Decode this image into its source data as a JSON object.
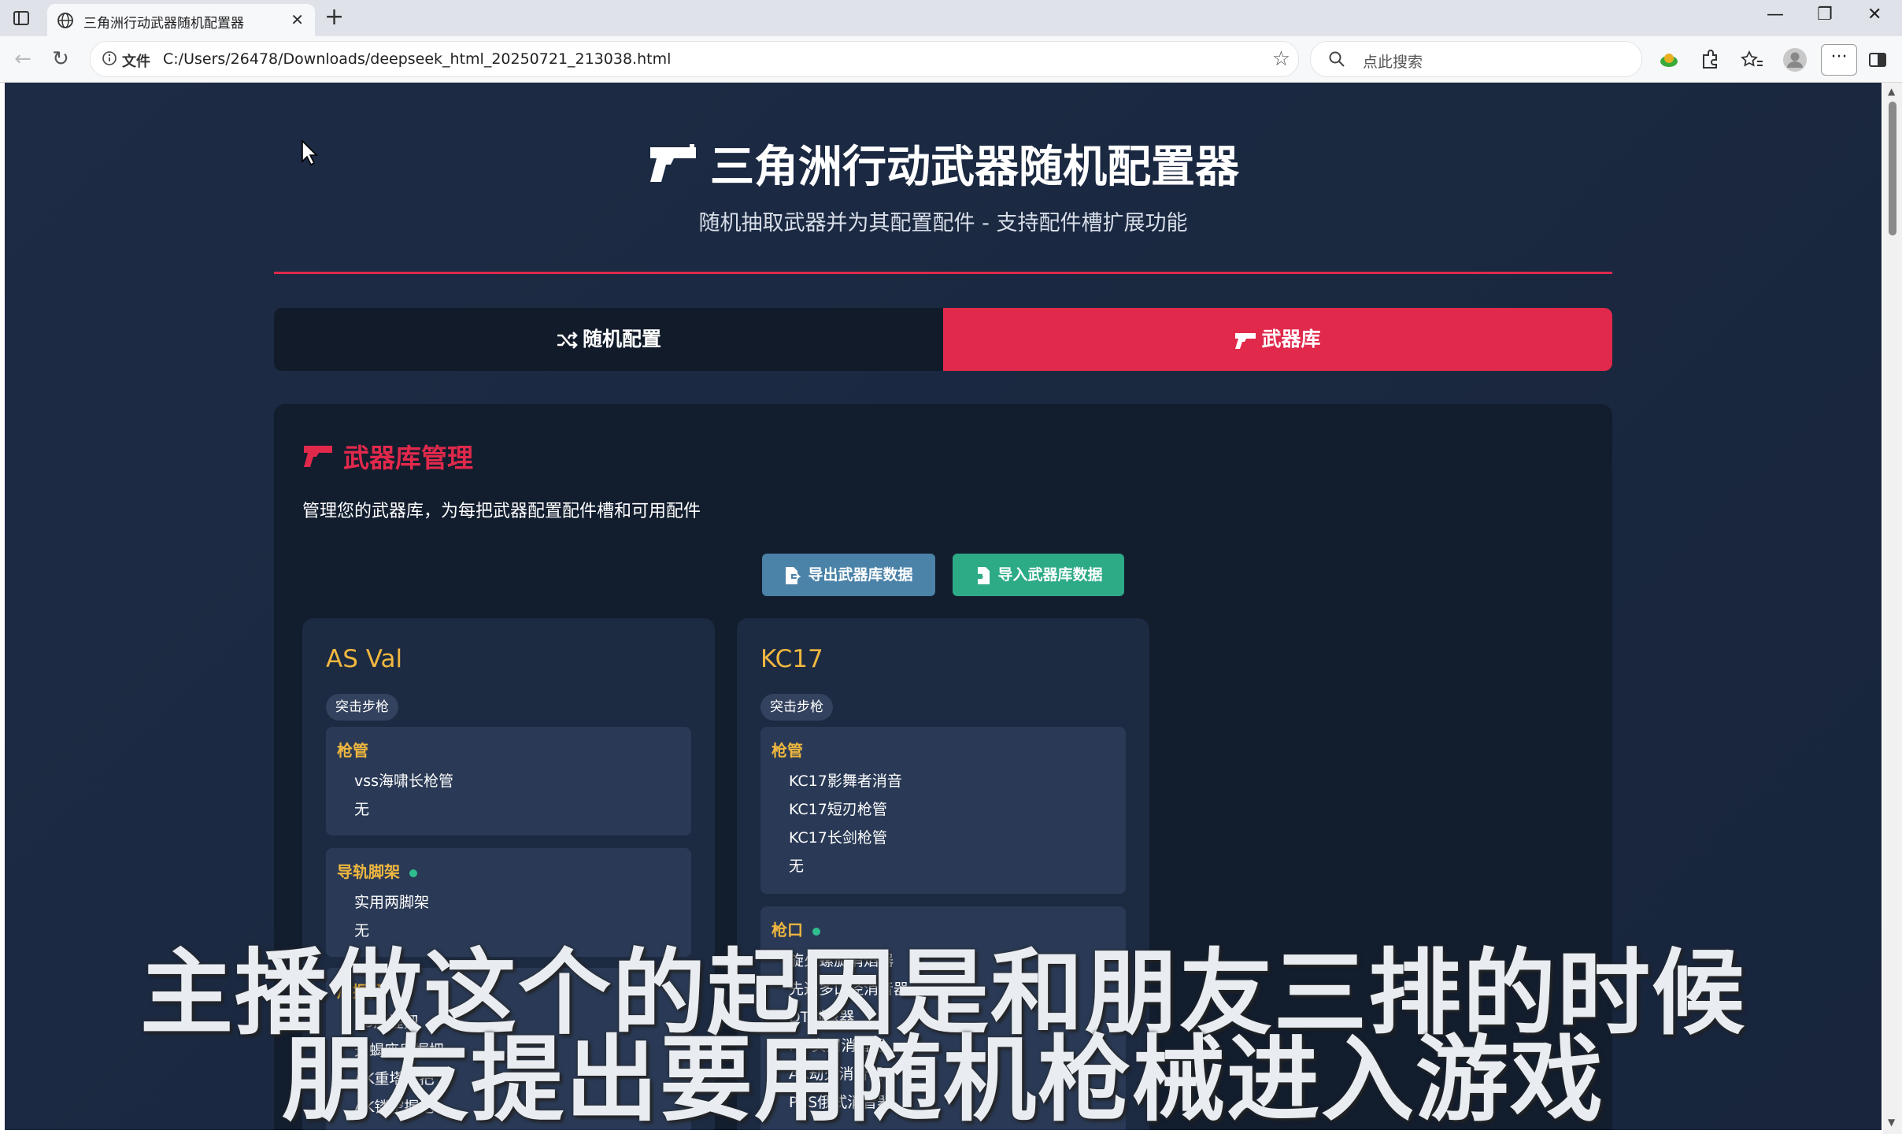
{
  "browser": {
    "tab_title": "三角洲行动武器随机配置器",
    "new_tab": "+",
    "tab_close": "✕",
    "address_label": "文件",
    "url": "C:/Users/26478/Downloads/deepseek_html_20250721_213038.html",
    "search_placeholder": "点此搜索",
    "window_controls": {
      "minimize": "—",
      "restore": "❐",
      "close": "✕"
    },
    "more": "···"
  },
  "page": {
    "title": "三角洲行动武器随机配置器",
    "subtitle": "随机抽取武器并为其配置配件 - 支持配件槽扩展功能",
    "tabs": [
      {
        "label": "随机配置",
        "active": false
      },
      {
        "label": "武器库",
        "active": true
      }
    ],
    "panel": {
      "title": "武器库管理",
      "description": "管理您的武器库，为每把武器配置配件槽和可用配件",
      "export_button": "导出武器库数据",
      "import_button": "导入武器库数据"
    },
    "weapons": [
      {
        "name": "AS Val",
        "type": "突击步枪",
        "slots": [
          {
            "name": "枪管",
            "options": [
              "vss海啸长枪管",
              "无"
            ]
          },
          {
            "name": "导轨脚架",
            "options": [
              "实用两脚架",
              "无"
            ]
          },
          {
            "name": "后握把",
            "options": [
              "K3后握把",
              "天蝎座后握把",
              "AK重塔握把",
              "AK镂空握把"
            ]
          }
        ]
      },
      {
        "name": "KC17",
        "type": "突击步枪",
        "slots": [
          {
            "name": "枪管",
            "options": [
              "KC17影舞者消音",
              "KC17短刃枪管",
              "KC17长剑枪管",
              "无"
            ]
          },
          {
            "name": "枪口",
            "options": [
              "旋火螺旋消焰器",
              "先进多口径消音器",
              "DT制退器",
              "M7实用消音器",
              "AK劫火消音器",
              "PBS俄式消音器"
            ]
          }
        ]
      }
    ]
  },
  "overlay_subtitle": {
    "line1": "主播做这个的起因是和朋友三排的时候",
    "line2": "朋友提出要用随机枪械进入游戏"
  },
  "colors": {
    "accent": "#e0294b",
    "gold": "#f0b73f",
    "export": "#4a82a8",
    "import": "#2daa86",
    "bg": "#1d2b45",
    "panel": "#121d2e"
  },
  "icons": {
    "title": "pistol-icon",
    "random_tab": "shuffle-icon",
    "library_tab": "pistol-icon",
    "export": "file-export-icon",
    "import": "file-import-icon"
  }
}
